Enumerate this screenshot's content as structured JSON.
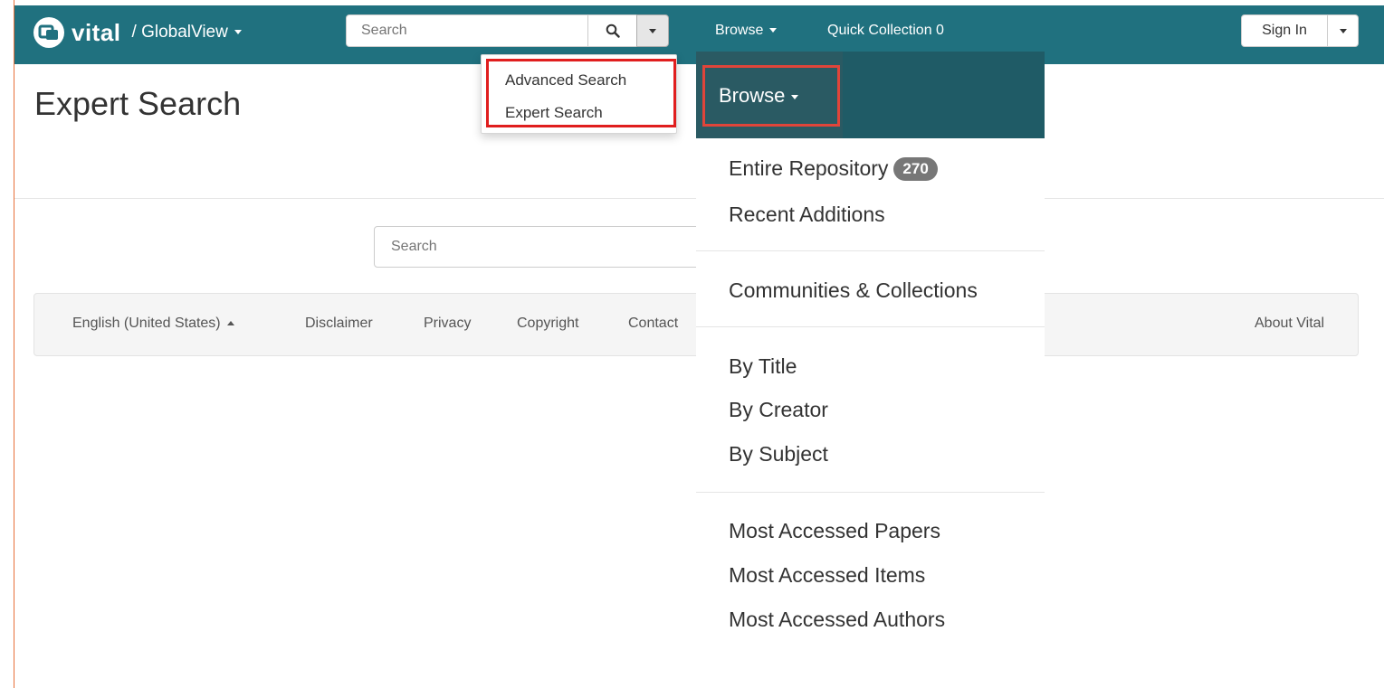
{
  "navbar": {
    "brand_name": "vital",
    "scope": "/ GlobalView",
    "search_placeholder": "Search",
    "browse_label": "Browse",
    "quick_collection_label": "Quick Collection 0",
    "sign_in_label": "Sign In"
  },
  "search_dropdown": {
    "items": [
      "Advanced Search",
      "Expert Search"
    ]
  },
  "page": {
    "title": "Expert Search",
    "search_placeholder": "Search"
  },
  "footer": {
    "language": "English (United States)",
    "links": [
      "Disclaimer",
      "Privacy",
      "Copyright",
      "Contact"
    ],
    "about": "About Vital"
  },
  "browse_menu": {
    "header": "Browse",
    "items": {
      "entire_repository": "Entire Repository",
      "entire_repository_count": "270",
      "recent_additions": "Recent Additions",
      "communities_collections": "Communities & Collections",
      "by_title": "By Title",
      "by_creator": "By Creator",
      "by_subject": "By Subject",
      "most_accessed_papers": "Most Accessed Papers",
      "most_accessed_items": "Most Accessed Items",
      "most_accessed_authors": "Most Accessed Authors"
    }
  },
  "colors": {
    "navbar": "#20717f",
    "browse_header": "#1f5b66",
    "highlight_red": "#e01e1e",
    "frame_orange": "#e8703a"
  }
}
